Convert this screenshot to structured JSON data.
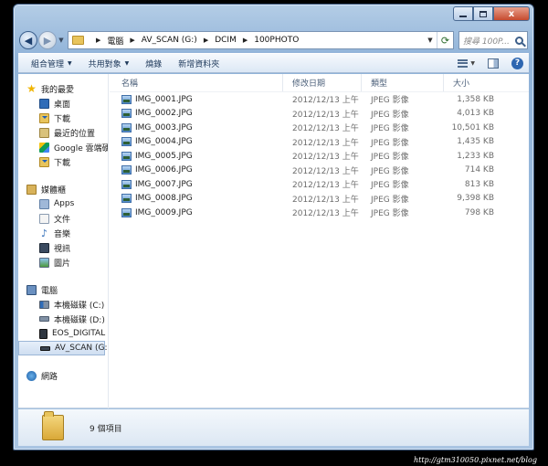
{
  "window": {
    "close_label": "x"
  },
  "address": {
    "crumbs": [
      "電腦",
      "AV_SCAN (G:)",
      "DCIM",
      "100PHOTO"
    ],
    "search_placeholder": "搜尋 100P..."
  },
  "toolbar": {
    "organize": "組合管理",
    "share": "共用對象",
    "burn": "燒錄",
    "new_folder": "新增資料夾"
  },
  "nav": {
    "favorites": {
      "label": "我的最愛",
      "items": [
        "桌面",
        "下載",
        "最近的位置",
        "Google 雲端硬",
        "下載"
      ]
    },
    "libraries": {
      "label": "媒體櫃",
      "items": [
        "Apps",
        "文件",
        "音樂",
        "視訊",
        "圖片"
      ]
    },
    "computer": {
      "label": "電腦",
      "items": [
        "本機磁碟 (C:)",
        "本機磁碟 (D:)",
        "EOS_DIGITAL (",
        "AV_SCAN (G:)"
      ]
    },
    "network": {
      "label": "網路"
    }
  },
  "columns": {
    "name": "名稱",
    "date": "修改日期",
    "type": "類型",
    "size": "大小"
  },
  "files": [
    {
      "name": "IMG_0001.JPG",
      "date": "2012/12/13 上午 ...",
      "type": "JPEG 影像",
      "size": "1,358 KB"
    },
    {
      "name": "IMG_0002.JPG",
      "date": "2012/12/13 上午 ...",
      "type": "JPEG 影像",
      "size": "4,013 KB"
    },
    {
      "name": "IMG_0003.JPG",
      "date": "2012/12/13 上午 ...",
      "type": "JPEG 影像",
      "size": "10,501 KB"
    },
    {
      "name": "IMG_0004.JPG",
      "date": "2012/12/13 上午 ...",
      "type": "JPEG 影像",
      "size": "1,435 KB"
    },
    {
      "name": "IMG_0005.JPG",
      "date": "2012/12/13 上午 ...",
      "type": "JPEG 影像",
      "size": "1,233 KB"
    },
    {
      "name": "IMG_0006.JPG",
      "date": "2012/12/13 上午 ...",
      "type": "JPEG 影像",
      "size": "714 KB"
    },
    {
      "name": "IMG_0007.JPG",
      "date": "2012/12/13 上午 ...",
      "type": "JPEG 影像",
      "size": "813 KB"
    },
    {
      "name": "IMG_0008.JPG",
      "date": "2012/12/13 上午 ...",
      "type": "JPEG 影像",
      "size": "9,398 KB"
    },
    {
      "name": "IMG_0009.JPG",
      "date": "2012/12/13 上午 ...",
      "type": "JPEG 影像",
      "size": "798 KB"
    }
  ],
  "status": {
    "item_count": "9 個項目"
  },
  "watermark": "http://gtm310050.pixnet.net/blog"
}
